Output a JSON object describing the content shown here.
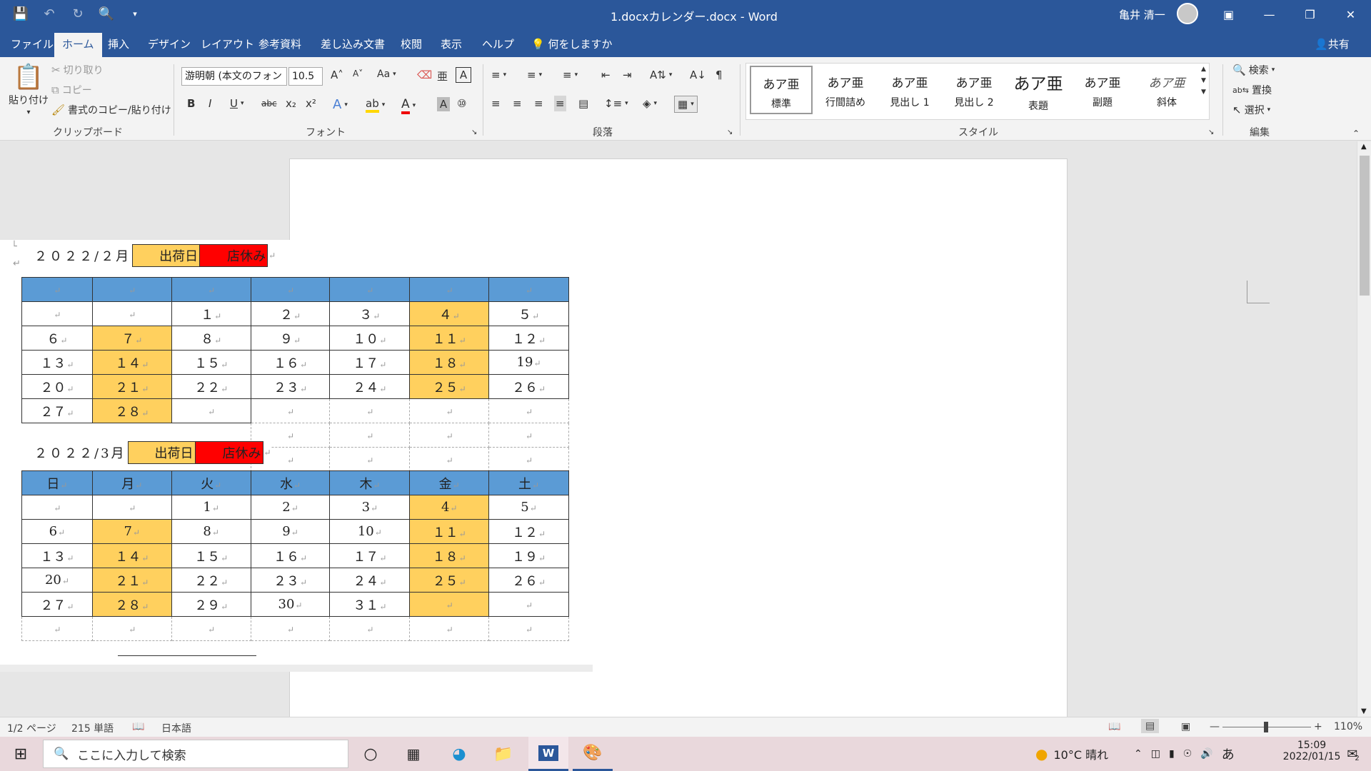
{
  "titlebar": {
    "doc_title": "1.docxカレンダー.docx  -  Word",
    "user_name": "亀井 清一"
  },
  "tabs": [
    {
      "label": "ファイル"
    },
    {
      "label": "ホーム"
    },
    {
      "label": "挿入"
    },
    {
      "label": "デザイン"
    },
    {
      "label": "レイアウト"
    },
    {
      "label": "参考資料"
    },
    {
      "label": "差し込み文書"
    },
    {
      "label": "校閲"
    },
    {
      "label": "表示"
    },
    {
      "label": "ヘルプ"
    }
  ],
  "tell_me": "何をしますか",
  "share": "共有",
  "ribbon": {
    "clipboard": {
      "paste": "貼り付け",
      "cut": "切り取り",
      "copy": "コピー",
      "format_painter": "書式のコピー/貼り付け",
      "group": "クリップボード"
    },
    "font": {
      "name": "游明朝 (本文のフォン",
      "size": "10.5",
      "group": "フォント",
      "case_button": "Aa"
    },
    "paragraph": {
      "group": "段落"
    },
    "styles": {
      "group": "スタイル",
      "items": [
        {
          "sample": "あア亜",
          "label": "標準"
        },
        {
          "sample": "あア亜",
          "label": "行間詰め"
        },
        {
          "sample": "あア亜",
          "label": "見出し 1"
        },
        {
          "sample": "あア亜",
          "label": "見出し 2"
        },
        {
          "sample": "あア亜",
          "label": "表題"
        },
        {
          "sample": "あア亜",
          "label": "副題"
        },
        {
          "sample": "あア亜",
          "label": "斜体"
        }
      ]
    },
    "editing": {
      "group": "編集",
      "find": "検索",
      "replace": "置換",
      "select": "選択"
    }
  },
  "document": {
    "feb": {
      "heading": "２０２２/２月",
      "ship": "出荷日",
      "closed": "店休み",
      "rows": [
        [
          "",
          "",
          "１",
          "２",
          "３",
          "４",
          "５"
        ],
        [
          "６",
          "７",
          "８",
          "９",
          "１０",
          "１１",
          "１２"
        ],
        [
          "１３",
          "１４",
          "１５",
          "１６",
          "１７",
          "１８",
          "19"
        ],
        [
          "２０",
          "２１",
          "２２",
          "２３",
          "２４",
          "２５",
          "２６"
        ],
        [
          "２７",
          "２８",
          "",
          "",
          "",
          "",
          ""
        ]
      ]
    },
    "mar": {
      "heading": "２０２２/3月",
      "ship": "出荷日",
      "closed": "店休み",
      "days": [
        "日",
        "月",
        "火",
        "水",
        "木",
        "金",
        "土"
      ],
      "rows": [
        [
          "",
          "",
          "1",
          "2",
          "3",
          "4",
          "5"
        ],
        [
          "6",
          "7",
          "8",
          "9",
          "10",
          "１１",
          "１２"
        ],
        [
          "１３",
          "１４",
          "１５",
          "１６",
          "１７",
          "１８",
          "１９"
        ],
        [
          "20",
          "２１",
          "２２",
          "２３",
          "２４",
          "２５",
          "２６"
        ],
        [
          "２７",
          "２８",
          "２９",
          "30",
          "３１",
          "",
          ""
        ],
        [
          "",
          "",
          "",
          "",
          "",
          "",
          ""
        ]
      ]
    }
  },
  "status": {
    "page": "1/2 ページ",
    "words": "215 単語",
    "language": "日本語",
    "zoom": "110%"
  },
  "taskbar": {
    "search_placeholder": "ここに入力して検索",
    "weather": "10°C  晴れ",
    "time": "15:09",
    "date": "2022/01/15",
    "ime": "あ",
    "notifications": "2"
  }
}
